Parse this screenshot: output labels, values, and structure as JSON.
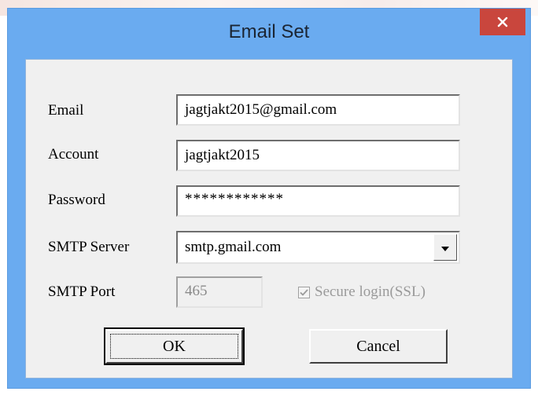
{
  "window": {
    "title": "Email Set"
  },
  "labels": {
    "email": "Email",
    "account": "Account",
    "password": "Password",
    "smtp_server": "SMTP Server",
    "smtp_port": "SMTP Port"
  },
  "fields": {
    "email_value": "jagtjakt2015@gmail.com",
    "account_value": "jagtjakt2015",
    "password_value": "************",
    "smtp_server_value": "smtp.gmail.com",
    "smtp_port_value": "465"
  },
  "ssl": {
    "label": "Secure login(SSL)",
    "checked": true,
    "disabled": true
  },
  "buttons": {
    "ok": "OK",
    "cancel": "Cancel"
  },
  "icons": {
    "close": "close-icon",
    "dropdown": "chevron-down-icon",
    "check": "check-icon"
  },
  "colors": {
    "titlebar": "#6aabf0",
    "close_button": "#c9463d",
    "dialog_face": "#f0f0f0"
  }
}
